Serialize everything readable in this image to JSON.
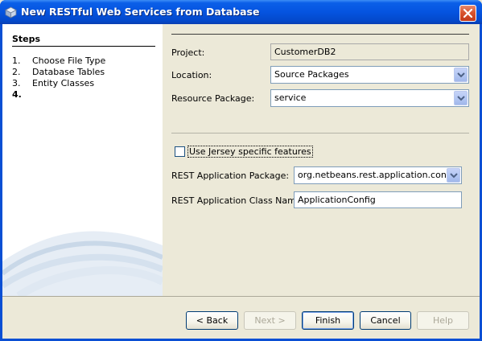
{
  "window": {
    "title": "New RESTful Web Services from Database"
  },
  "steps": {
    "header": "Steps",
    "items": [
      {
        "num": "1.",
        "label": "Choose File Type"
      },
      {
        "num": "2.",
        "label": "Database Tables"
      },
      {
        "num": "3.",
        "label": "Entity Classes"
      },
      {
        "num": "4.",
        "label": ""
      }
    ]
  },
  "form": {
    "project_label": "Project:",
    "project_value": "CustomerDB2",
    "location_label": "Location:",
    "location_value": "Source Packages",
    "resource_package_label": "Resource Package:",
    "resource_package_value": "service",
    "jersey_checkbox_label": "Use Jersey specific features",
    "jersey_checked": false,
    "rest_app_package_label": "REST Application Package:",
    "rest_app_package_value": "org.netbeans.rest.application.config",
    "rest_app_class_label": "REST Application Class Name:",
    "rest_app_class_value": "ApplicationConfig"
  },
  "buttons": {
    "back": "< Back",
    "next": "Next >",
    "finish": "Finish",
    "cancel": "Cancel",
    "help": "Help"
  },
  "colors": {
    "titlebar": "#0554e0",
    "dialog_bg": "#ece9d8",
    "close_button": "#d9542f"
  }
}
